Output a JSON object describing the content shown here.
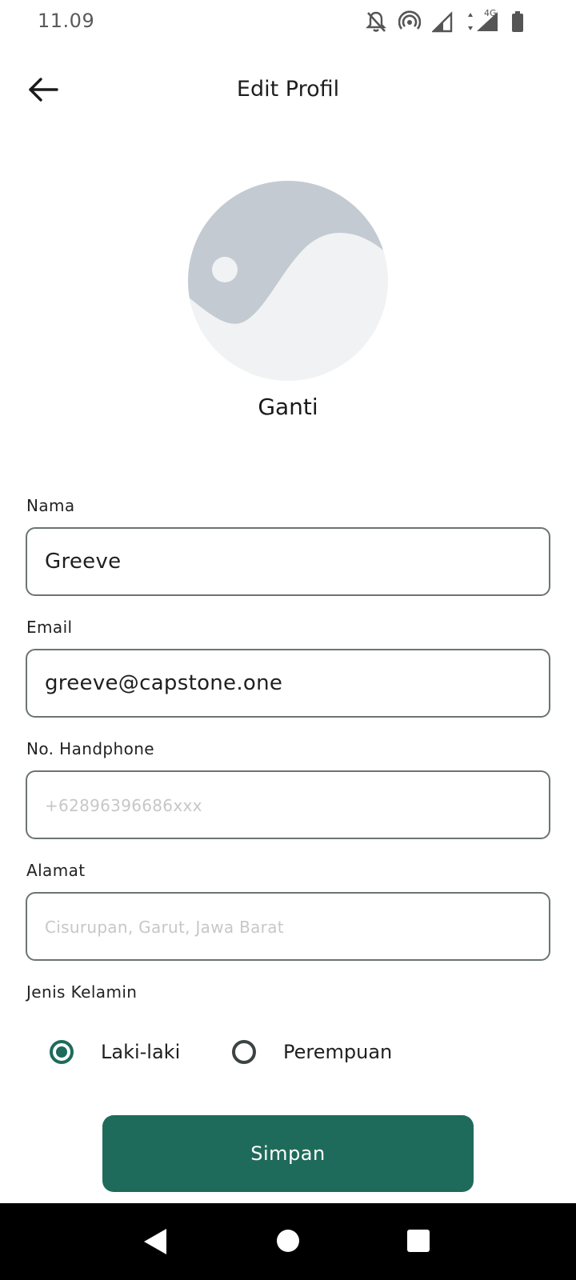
{
  "status_bar": {
    "time": "11.09",
    "network_label": "4G",
    "icons": [
      "notifications-off-icon",
      "hotspot-icon",
      "signal-icon",
      "signal-4g-icon",
      "battery-icon"
    ]
  },
  "app_bar": {
    "back_icon": "arrow-left-icon",
    "title": "Edit Profil"
  },
  "profile": {
    "avatar_icon": "image-placeholder-icon",
    "change_label": "Ganti"
  },
  "form": {
    "name": {
      "label": "Nama",
      "value": "Greeve",
      "placeholder": ""
    },
    "email": {
      "label": "Email",
      "value": "greeve@capstone.one",
      "placeholder": ""
    },
    "phone": {
      "label": "No. Handphone",
      "value": "",
      "placeholder": "+62896396686xxx"
    },
    "address": {
      "label": "Alamat",
      "value": "",
      "placeholder": "Cisurupan, Garut, Jawa Barat"
    },
    "gender": {
      "label": "Jenis Kelamin",
      "options": [
        {
          "label": "Laki-laki",
          "selected": true
        },
        {
          "label": "Perempuan",
          "selected": false
        }
      ]
    },
    "save_label": "Simpan"
  },
  "colors": {
    "primary": "#1f6b5b",
    "field_border": "#6c7373",
    "placeholder": "#c7c7c7",
    "avatar_bg": "#f0f2f3",
    "avatar_shape": "#c3cad1"
  },
  "nav_bar": {
    "icons": [
      "back-triangle-icon",
      "home-circle-icon",
      "recents-square-icon"
    ]
  }
}
